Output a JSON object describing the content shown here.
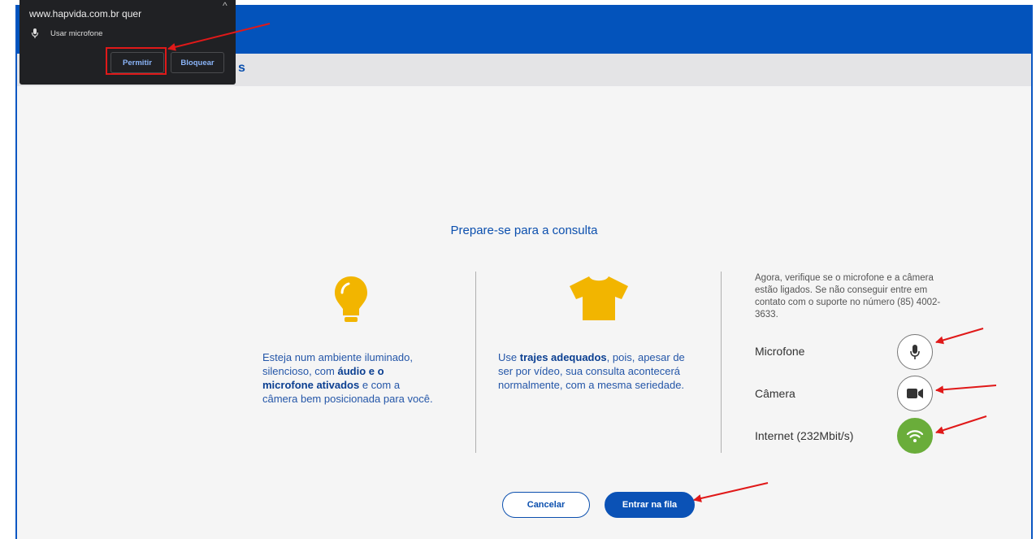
{
  "popup": {
    "origin": "www.hapvida.com.br quer",
    "permission": "Usar microfone",
    "allow_label": "Permitir",
    "block_label": "Bloquear"
  },
  "subbar": {
    "partial_text": "s"
  },
  "main": {
    "title": "Prepare-se para a consulta",
    "tip1": {
      "pre": "Esteja num ambiente iluminado, silencioso, com ",
      "bold": "áudio e o microfone ativados",
      "post": " e com a câmera bem posicionada para você."
    },
    "tip2": {
      "pre": "Use ",
      "bold": "trajes adequados",
      "post": ", pois, apesar de ser por vídeo, sua consulta acontecerá normalmente, com a mesma seriedade."
    },
    "check_info": "Agora, verifique se o microfone e a câmera estão ligados. Se não conseguir entre em contato com o suporte no número (85) 4002-3633.",
    "microphone_label": "Microfone",
    "camera_label": "Câmera",
    "internet_label": "Internet (232Mbit/s)",
    "cancel_label": "Cancelar",
    "enter_label": "Entrar na fila"
  },
  "colors": {
    "brand_blue": "#0353bb",
    "accent_yellow": "#f2b500",
    "status_green": "#6aad3a",
    "annotation_red": "#e01919"
  }
}
